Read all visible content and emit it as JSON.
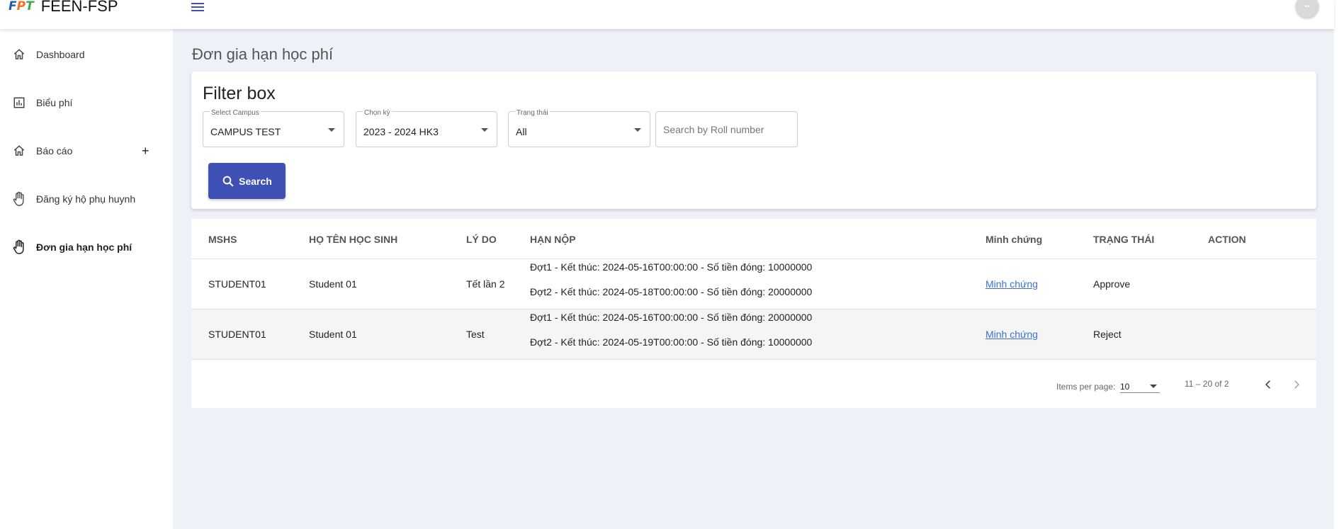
{
  "app": {
    "logo_text": "FPT",
    "title": "FEEN-FSP"
  },
  "sidebar": {
    "items": [
      {
        "label": "Dashboard",
        "icon": "home-icon"
      },
      {
        "label": "Biểu phí",
        "icon": "bar-chart-icon"
      },
      {
        "label": "Báo cáo",
        "icon": "home-icon",
        "expand": "+"
      },
      {
        "label": "Đăng ký hộ phụ huynh",
        "icon": "hand-icon"
      },
      {
        "label": "Đơn gia hạn học phí",
        "icon": "hand-icon",
        "active": true
      }
    ]
  },
  "page": {
    "title": "Đơn gia hạn học phí"
  },
  "filter": {
    "title": "Filter box",
    "campus": {
      "label": "Select Campus",
      "value": "CAMPUS TEST"
    },
    "term": {
      "label": "Chọn kỳ",
      "value": "2023 - 2024 HK3"
    },
    "status": {
      "label": "Trạng thái",
      "value": "All"
    },
    "roll": {
      "placeholder": "Search by Roll number"
    },
    "search_label": "Search"
  },
  "table": {
    "headers": [
      "MSHS",
      "HỌ TÊN HỌC SINH",
      "LÝ DO",
      "HẠN NỘP",
      "Minh chứng",
      "TRẠNG THÁI",
      "ACTION"
    ],
    "rows": [
      {
        "mshs": "STUDENT01",
        "name": "Student 01",
        "reason": "Tết lần 2",
        "deadline1": "Đợt1 - Kết thúc: 2024-05-16T00:00:00 - Số tiền đóng: 10000000",
        "deadline2": "Đợt2 - Kết thúc: 2024-05-18T00:00:00 - Số tiền đóng: 20000000",
        "evidence": "Minh chứng",
        "status": "Approve"
      },
      {
        "mshs": "STUDENT01",
        "name": "Student 01",
        "reason": "Test",
        "deadline1": "Đợt1 - Kết thúc: 2024-05-16T00:00:00 - Số tiền đóng: 20000000",
        "deadline2": "Đợt2 - Kết thúc: 2024-05-19T00:00:00 - Số tiền đóng: 10000000",
        "evidence": "Minh chứng",
        "status": "Reject"
      }
    ]
  },
  "paginator": {
    "items_per_page_label": "Items per page:",
    "page_size": "10",
    "range": "11 – 20 of 2"
  },
  "colors": {
    "primary": "#3f51b5",
    "background": "#eef1f8",
    "link": "#3b6fd8"
  }
}
